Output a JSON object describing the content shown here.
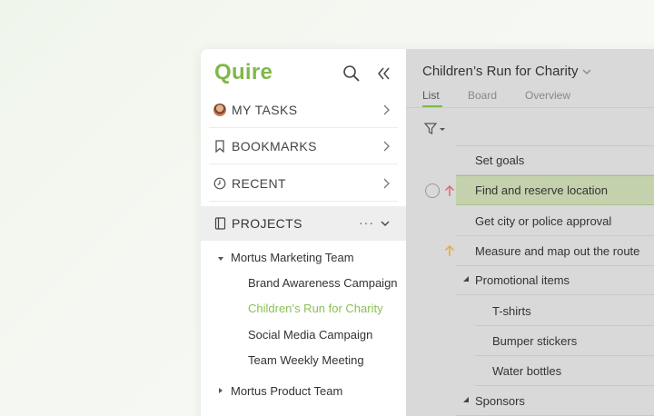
{
  "app": {
    "logo": "Quire"
  },
  "sidebar": {
    "nav": [
      {
        "label": "MY TASKS",
        "icon": "avatar"
      },
      {
        "label": "BOOKMARKS",
        "icon": "bookmark-icon"
      },
      {
        "label": "RECENT",
        "icon": "clock-icon"
      }
    ],
    "projects": {
      "label": "PROJECTS",
      "more": "···",
      "teams": [
        {
          "name": "Mortus Marketing Team",
          "expanded": true,
          "projects": [
            {
              "name": "Brand Awareness Campaign",
              "active": false
            },
            {
              "name": "Children’s Run for Charity",
              "active": true
            },
            {
              "name": "Social Media Campaign",
              "active": false
            },
            {
              "name": "Team Weekly Meeting",
              "active": false
            }
          ]
        },
        {
          "name": "Mortus Product Team",
          "expanded": false
        }
      ]
    }
  },
  "main": {
    "title": "Children’s Run for Charity",
    "tabs": [
      {
        "label": "List",
        "active": true
      },
      {
        "label": "Board",
        "active": false
      },
      {
        "label": "Overview",
        "active": false
      }
    ],
    "tasks": [
      {
        "text": "Set goals",
        "priority": null
      },
      {
        "text": "Find and reserve location",
        "priority": "high",
        "selected": true
      },
      {
        "text": "Get city or police approval",
        "priority": null
      },
      {
        "text": "Measure and map out the route",
        "priority": "medium"
      },
      {
        "text": "Promotional items",
        "group": true
      },
      {
        "text": "T-shirts",
        "sub": true
      },
      {
        "text": "Bumper stickers",
        "sub": true
      },
      {
        "text": "Water bottles",
        "sub": true
      },
      {
        "text": "Sponsors",
        "group": true
      }
    ]
  },
  "colors": {
    "accent": "#7fb94a",
    "active_project": "#8cbf55",
    "priority_high": "#e06a6a",
    "priority_medium": "#e8a93c",
    "selected_row": "#c3d2ad"
  }
}
